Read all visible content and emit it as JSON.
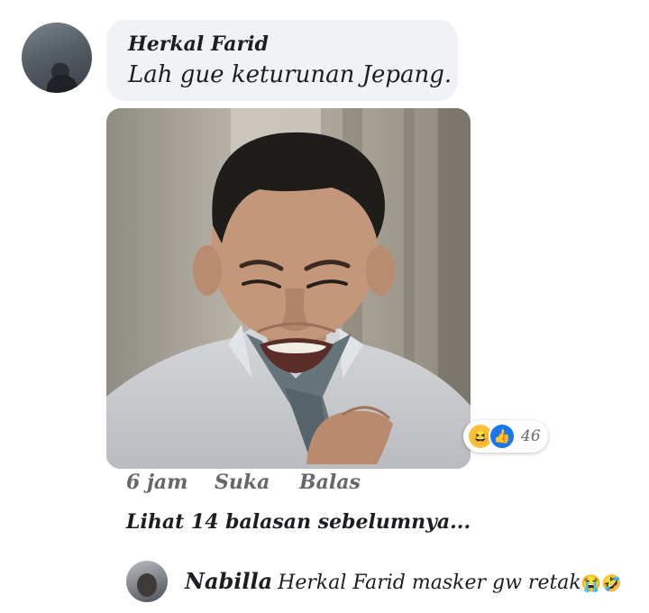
{
  "comment": {
    "author": "Herkal Farid",
    "text": "Lah gue keturunan Jepang.",
    "reactions": {
      "icons": [
        "haha-icon",
        "like-icon"
      ],
      "count": "46"
    },
    "actions": {
      "time": "6 jam",
      "like": "Suka",
      "reply": "Balas"
    }
  },
  "more_replies": "Lihat 14 balasan sebelumnya...",
  "reply": {
    "author": "Nabilla",
    "text": "Herkal Farid masker gw retak",
    "emoji": "😭🤣"
  },
  "colors": {
    "bubble": "#f0f2f5",
    "like_blue": "#1877f2",
    "haha_yellow": "#f7c23b",
    "meta_gray": "#65676b"
  }
}
